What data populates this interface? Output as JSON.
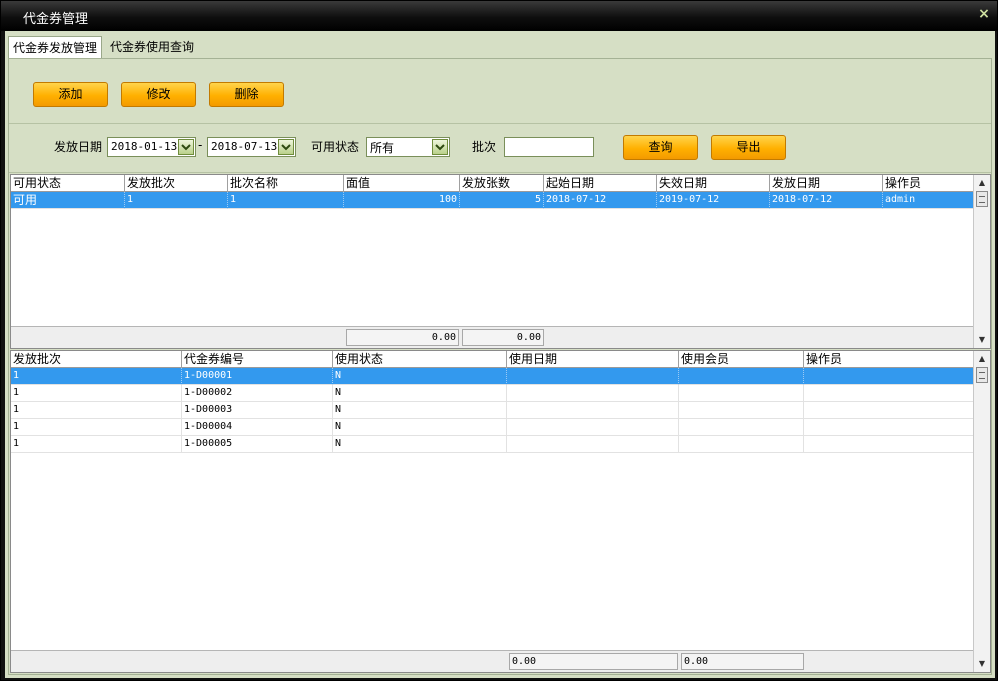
{
  "window": {
    "title": "代金券管理",
    "close_glyph": "×"
  },
  "tabs": [
    {
      "label": "代金券发放管理",
      "active": true
    },
    {
      "label": "代金券使用查询",
      "active": false
    }
  ],
  "toolbar": {
    "add": "添加",
    "edit": "修改",
    "delete": "删除"
  },
  "filter": {
    "date_label": "发放日期",
    "date_from": "2018-01-13",
    "date_sep": "-",
    "date_to": "2018-07-13",
    "status_label": "可用状态",
    "status_value": "所有",
    "batch_label": "批次",
    "batch_value": "",
    "query": "查询",
    "export": "导出"
  },
  "batch_table": {
    "columns": [
      "可用状态",
      "发放批次",
      "批次名称",
      "面值",
      "发放张数",
      "起始日期",
      "失效日期",
      "发放日期",
      "操作员"
    ],
    "rows": [
      [
        "可用",
        "1",
        "1",
        "100",
        "5",
        "2018-07-12",
        "2019-07-12",
        "2018-07-12",
        "admin"
      ]
    ],
    "totals": [
      "0.00",
      "0.00"
    ]
  },
  "coupon_table": {
    "columns": [
      "发放批次",
      "代金券编号",
      "使用状态",
      "使用日期",
      "使用会员",
      "操作员"
    ],
    "rows": [
      [
        "1",
        "1-D00001",
        "N",
        "",
        "",
        ""
      ],
      [
        "1",
        "1-D00002",
        "N",
        "",
        "",
        ""
      ],
      [
        "1",
        "1-D00003",
        "N",
        "",
        "",
        ""
      ],
      [
        "1",
        "1-D00004",
        "N",
        "",
        "",
        ""
      ],
      [
        "1",
        "1-D00005",
        "N",
        "",
        "",
        ""
      ]
    ],
    "totals": [
      "0.00",
      "0.00"
    ]
  },
  "colors": {
    "accent_button": "#ffb000",
    "panel_bg": "#d6dfc5",
    "selected_row": "#3399ee",
    "titlebar": "#000000"
  }
}
